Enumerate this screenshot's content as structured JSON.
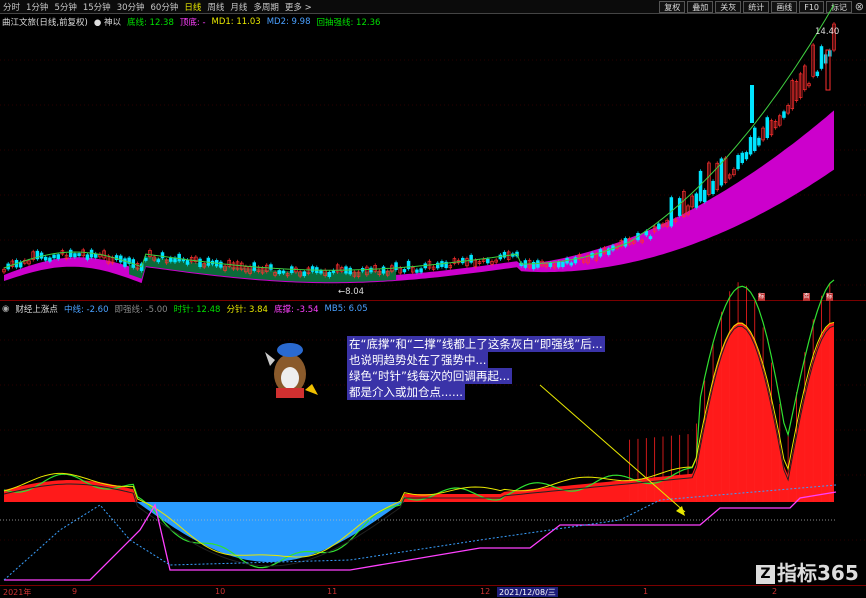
{
  "toolbar": {
    "periods": [
      "分时",
      "1分钟",
      "5分钟",
      "15分钟",
      "30分钟",
      "60分钟",
      "日线",
      "周线",
      "月线",
      "多周期",
      "更多 >"
    ],
    "active_period": "日线",
    "right_buttons": [
      "复权",
      "叠加",
      "关灰",
      "统计",
      "画线",
      "F10",
      "标记"
    ]
  },
  "main_info": {
    "title": "曲江文旅(日线,前复权)",
    "sub": "● 神以",
    "items": [
      {
        "text": "底线: 12.38",
        "color": "#00e000"
      },
      {
        "text": "顶底: -",
        "color": "#ff40ff"
      },
      {
        "text": "MD1: 11.03",
        "color": "#e8e800"
      },
      {
        "text": "MD2: 9.98",
        "color": "#4aa0ff"
      },
      {
        "text": "回抽强线: 12.36",
        "color": "#00e000"
      }
    ]
  },
  "price_labels": {
    "max": "14.40",
    "min": "8.04"
  },
  "sub_info": {
    "title": "财经上涨点",
    "items": [
      {
        "text": "中线: -2.60",
        "color": "#4aa0ff"
      },
      {
        "text": "即强线: -5.00",
        "color": "#888888"
      },
      {
        "text": "时针: 12.48",
        "color": "#00e000"
      },
      {
        "text": "分针: 3.84",
        "color": "#e8e800"
      },
      {
        "text": "底撑: -3.54",
        "color": "#ff40ff"
      },
      {
        "text": "MB5: 6.05",
        "color": "#4aa0ff"
      }
    ]
  },
  "annotation": {
    "line1": "在“底撑”和“二撑”线都上了这条灰白“即强线”后...",
    "line2": "也说明趋势处在了强势中...",
    "line3": "绿色“时针”线每次的回调再起...",
    "line4": "都是介入或加仓点......"
  },
  "xaxis": {
    "labels": [
      {
        "text": "2021年",
        "pos": 3
      },
      {
        "text": "9",
        "pos": 72
      },
      {
        "text": "10",
        "pos": 215
      },
      {
        "text": "11",
        "pos": 327
      },
      {
        "text": "12",
        "pos": 480
      },
      {
        "text": "1",
        "pos": 643
      },
      {
        "text": "2",
        "pos": 772
      }
    ],
    "cursor": "2021/12/08/三"
  },
  "watermark": {
    "badge": "Z",
    "text": "指标365"
  },
  "flags": [
    "标",
    "否",
    "标"
  ],
  "colors": {
    "up": "#ff3030",
    "down": "#00e5ff",
    "ma_green": "#0b6b3a",
    "band": "#cc00cc",
    "accent": "#e8e800"
  }
}
